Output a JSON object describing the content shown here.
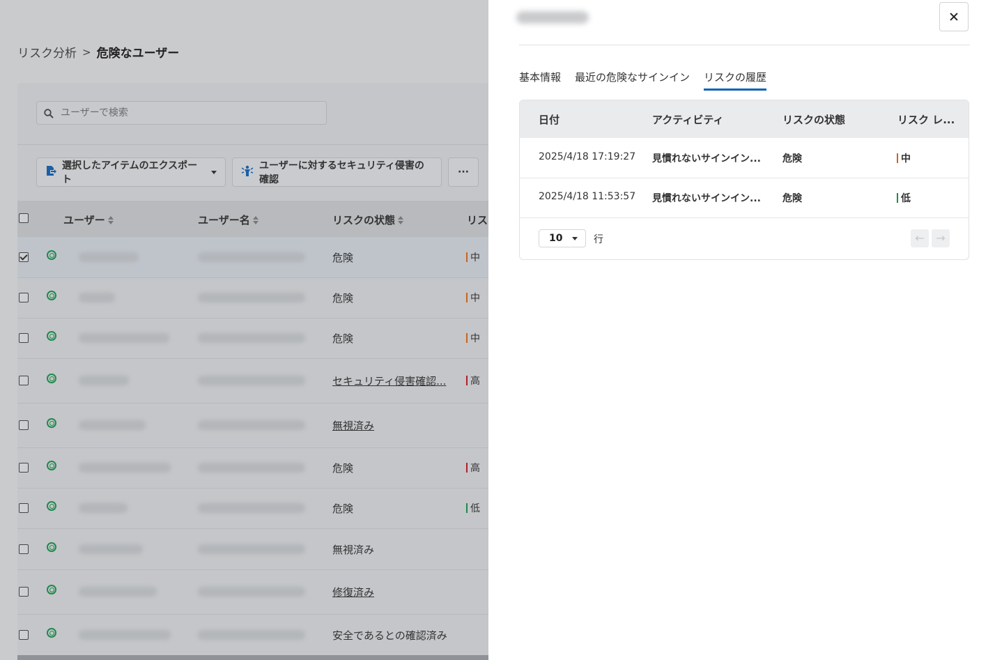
{
  "breadcrumb": {
    "parent": "リスク分析",
    "current": "危険なユーザー"
  },
  "search": {
    "placeholder": "ユーザーで検索"
  },
  "toolbar": {
    "export_label": "選択したアイテムのエクスポート",
    "confirm_label": "ユーザーに対するセキュリティ侵害の確認",
    "more_label": "···"
  },
  "table": {
    "headers": {
      "user": "ユーザー",
      "username": "ユーザー名",
      "risk_state": "リスクの状態",
      "risk_level": "リス"
    },
    "rows": [
      {
        "state": "危険",
        "level": "中",
        "level_color": "#c8641e",
        "checked": true,
        "link": false
      },
      {
        "state": "危険",
        "level": "中",
        "level_color": "#c8641e",
        "checked": false,
        "link": false
      },
      {
        "state": "危険",
        "level": "中",
        "level_color": "#c8641e",
        "checked": false,
        "link": false
      },
      {
        "state": "セキュリティ侵害確認...",
        "level": "高",
        "level_color": "#b0202a",
        "checked": false,
        "link": true
      },
      {
        "state": "無視済み",
        "level": "",
        "level_color": "",
        "checked": false,
        "link": true
      },
      {
        "state": "危険",
        "level": "高",
        "level_color": "#b0202a",
        "checked": false,
        "link": false
      },
      {
        "state": "危険",
        "level": "低",
        "level_color": "#1e8a4a",
        "checked": false,
        "link": false
      },
      {
        "state": "無視済み",
        "level": "",
        "level_color": "",
        "checked": false,
        "link": false
      },
      {
        "state": "修復済み",
        "level": "",
        "level_color": "",
        "checked": false,
        "link": true
      },
      {
        "state": "安全であるとの確認済み",
        "level": "",
        "level_color": "",
        "checked": false,
        "link": false
      }
    ]
  },
  "panel": {
    "tabs": [
      "基本情報",
      "最近の危険なサインイン",
      "リスクの履歴"
    ],
    "active_tab": 2,
    "history": {
      "headers": {
        "date": "日付",
        "activity": "アクティビティ",
        "state": "リスクの状態",
        "level": "リスク レ..."
      },
      "rows": [
        {
          "date": "2025/4/18 17:19:27",
          "activity": "見慣れないサインイン...",
          "state": "危険",
          "level": "中",
          "level_color": "#c8641e"
        },
        {
          "date": "2025/4/18 11:53:57",
          "activity": "見慣れないサインイン...",
          "state": "危険",
          "level": "低",
          "level_color": "#1e8a4a"
        }
      ],
      "page_size": "10",
      "rows_label": "行"
    }
  },
  "colors": {
    "accent": "#0a62b6",
    "medium": "#c8641e",
    "high": "#b0202a",
    "low": "#1e8a4a"
  },
  "icons": [
    "search-icon",
    "export-icon",
    "chevron-down-icon",
    "person-alert-icon",
    "risk-target-icon",
    "close-icon",
    "arrow-left-icon",
    "arrow-right-icon"
  ]
}
